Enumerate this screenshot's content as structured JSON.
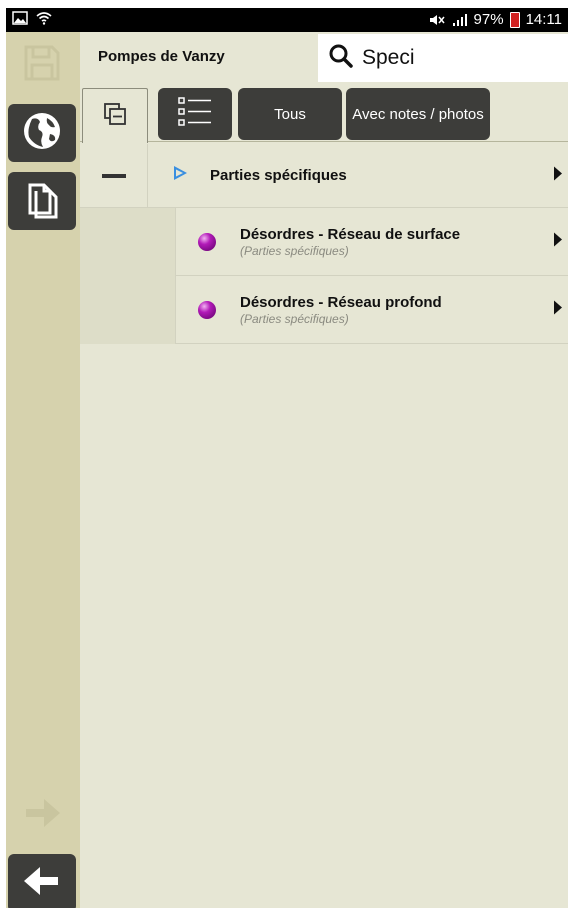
{
  "status": {
    "battery": "97%",
    "time": "14:11"
  },
  "header": {
    "title": "Pompes de Vanzy",
    "search_value": "Speci"
  },
  "toolbar": {
    "all_label": "Tous",
    "notes_label": "Avec notes / photos"
  },
  "tree": {
    "root_label": "Parties spécifiques",
    "children": [
      {
        "title": "Désordres - Réseau de surface",
        "subtitle": "(Parties spécifiques)"
      },
      {
        "title": "Désordres - Réseau profond",
        "subtitle": "(Parties spécifiques)"
      }
    ]
  },
  "colors": {
    "background": "#e6e6d4",
    "sidebar": "#d6d2ad",
    "button_dark": "#3d3d3a",
    "node_purple": "#b21ab8",
    "play_blue": "#3a8fe0"
  },
  "icons": {
    "sidebar": [
      "save-icon",
      "globe-icon",
      "copy-icon",
      "arrow-right-icon",
      "arrow-left-icon"
    ],
    "toolbar": [
      "collapse-all-icon",
      "list-icon"
    ]
  }
}
